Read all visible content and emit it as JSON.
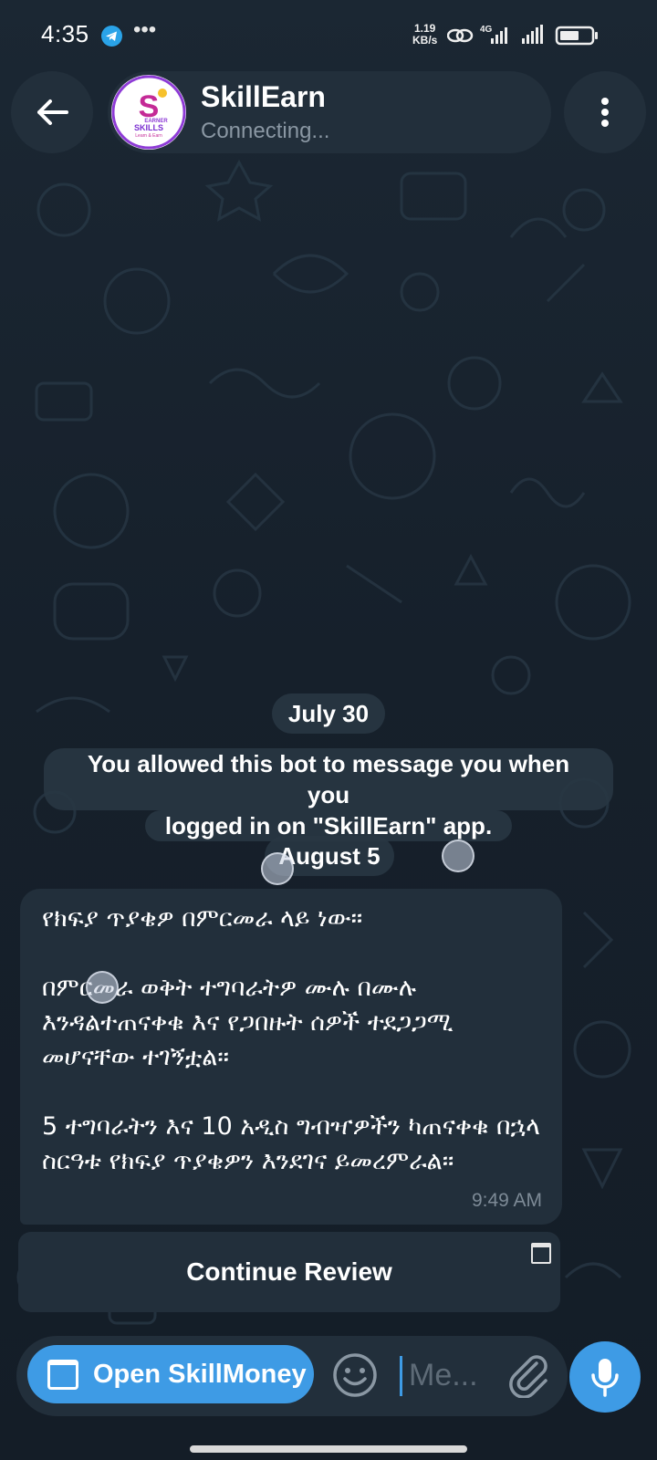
{
  "status_bar": {
    "time": "4:35",
    "more_indicator": "•••",
    "net_speed_value": "1.19",
    "net_speed_unit": "KB/s",
    "network_type": "4G",
    "icons": [
      "telegram-notification-icon",
      "link-icon",
      "signal-4g-icon",
      "signal-icon",
      "battery-icon"
    ]
  },
  "header": {
    "chat_name": "SkillEarn",
    "chat_status": "Connecting...",
    "avatar_letter": "S",
    "avatar_text": "SKILLS",
    "avatar_caption": "EARNER",
    "avatar_tagline": "Learn & Earn"
  },
  "messages": {
    "date1": "July 30",
    "service_line1": "You allowed this bot to message you when you",
    "service_line2": "logged in on \"SkillEarn\" app.",
    "date2": "August 5",
    "bubble_text": "የክፍያ ጥያቄዎ በምርመራ ላይ ነው።\n\nበምርመራ ወቅት ተግባራትዎ ሙሉ በሙሉ እንዳልተጠናቀቁ እና የጋበዙት ሰዎች ተደጋጋሚ መሆናቸው ተገኝቷል።\n\n5 ተግባራትን እና 10 አዲስ ግብዣዎችን ካጠናቀቁ በኋላ ስርዓቱ የክፍያ ጥያቄዎን እንደገና ይመረምራል።",
    "bubble_time": "9:49 AM"
  },
  "inline_keyboard": {
    "button_label": "Continue Review"
  },
  "composer": {
    "open_app_label": "Open SkillMoney",
    "placeholder": "Me..."
  },
  "colors": {
    "background": "#17212b",
    "surface": "#222f3b",
    "accent": "#3e9be5",
    "secondary_text": "#8a97a3"
  }
}
